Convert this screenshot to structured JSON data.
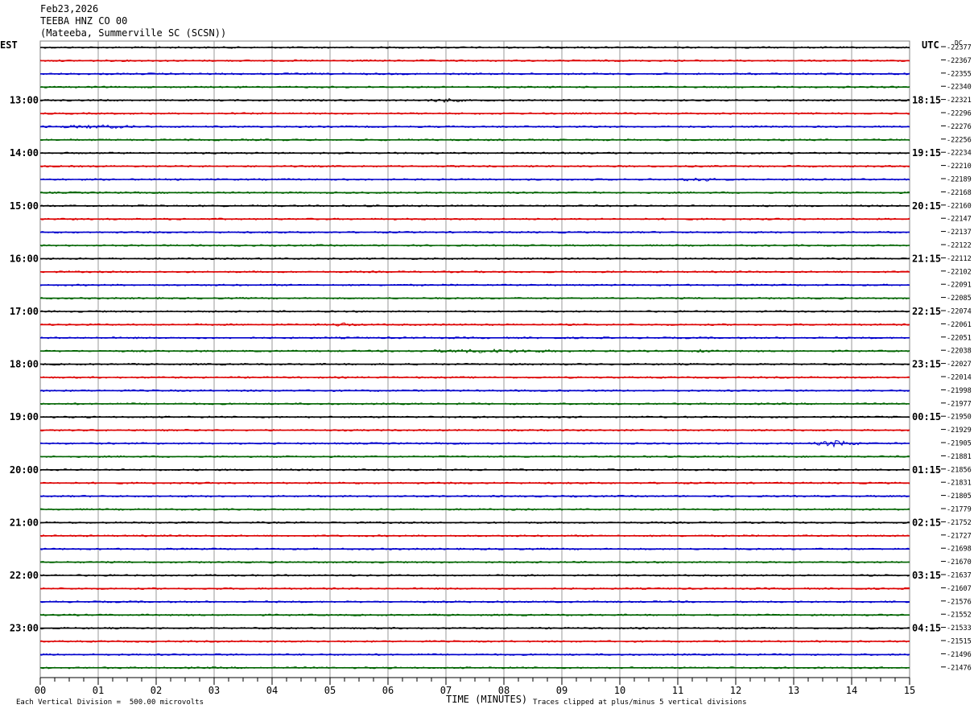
{
  "header": {
    "date": "Feb23,2026",
    "station": "TEEBA HNZ CO 00",
    "location": "(Mateeba, Summerville SC (SCSN))"
  },
  "labels": {
    "left_timezone": "EST",
    "right_timezone": "UTC",
    "dc_header": "DC"
  },
  "footer": {
    "scale": "Each Vertical Division =  500.00 microvolts",
    "clip": "Traces clipped at plus/minus 5 vertical divisions"
  },
  "chart_data": {
    "type": "line",
    "title": "TEEBA HNZ CO 00",
    "xlabel": "TIME (MINUTES)",
    "x_ticks": [
      "00",
      "01",
      "02",
      "03",
      "04",
      "05",
      "06",
      "07",
      "08",
      "09",
      "10",
      "11",
      "12",
      "13",
      "14",
      "15"
    ],
    "xlim": [
      0,
      15
    ],
    "grid": true,
    "trace_colors": [
      "#000000",
      "#dd0000",
      "#0000cc",
      "#006400"
    ],
    "left_hour_labels": [
      "13:00",
      "14:00",
      "15:00",
      "16:00",
      "17:00",
      "18:00",
      "19:00",
      "20:00",
      "21:00",
      "22:00",
      "23:00"
    ],
    "right_hour_labels": [
      "18:15",
      "19:15",
      "20:15",
      "21:15",
      "22:15",
      "23:15",
      "00:15",
      "01:15",
      "02:15",
      "03:15",
      "04:15"
    ],
    "dc_offsets": [
      -22377,
      -22367,
      -22355,
      -22340,
      -22321,
      -22296,
      -22276,
      -22256,
      -22234,
      -22210,
      -22189,
      -22168,
      -22160,
      -22147,
      -22137,
      -22122,
      -22112,
      -22102,
      -22091,
      -22085,
      -22074,
      -22061,
      -22051,
      -22038,
      -22027,
      -22014,
      -21998,
      -21977,
      -21950,
      -21929,
      -21905,
      -21881,
      -21856,
      -21831,
      -21805,
      -21779,
      -21752,
      -21727,
      -21698,
      -21670,
      -21637,
      -21607,
      -21576,
      -21552,
      -21533,
      -21515,
      -21496,
      -21476
    ]
  }
}
